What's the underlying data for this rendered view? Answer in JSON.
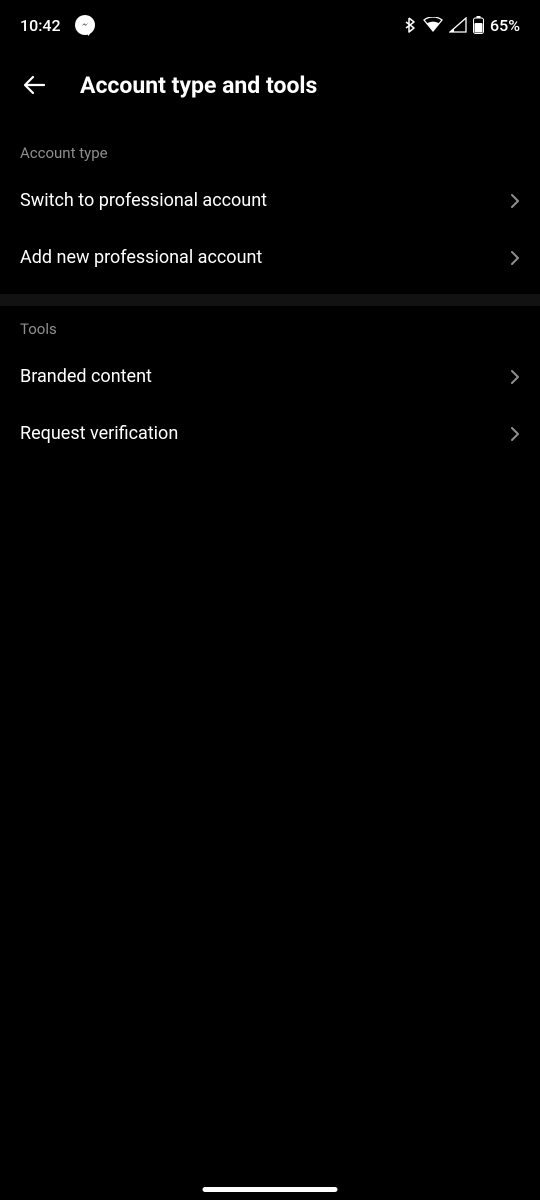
{
  "status_bar": {
    "time": "10:42",
    "battery_percent": "65%"
  },
  "header": {
    "title": "Account type and tools"
  },
  "sections": {
    "account_type": {
      "header": "Account type",
      "items": [
        {
          "label": "Switch to professional account"
        },
        {
          "label": "Add new professional account"
        }
      ]
    },
    "tools": {
      "header": "Tools",
      "items": [
        {
          "label": "Branded content"
        },
        {
          "label": "Request verification"
        }
      ]
    }
  }
}
